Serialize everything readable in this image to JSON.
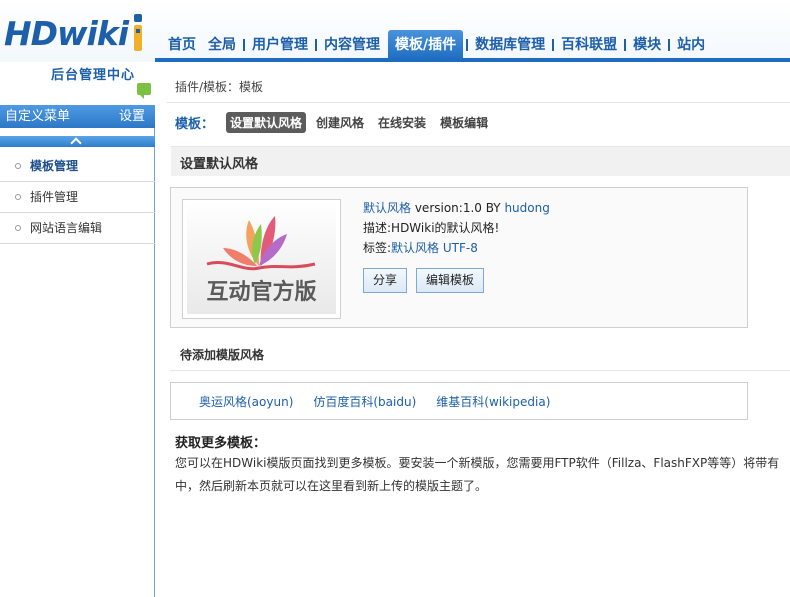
{
  "brand": {
    "logo": "HDwiki",
    "subtitle": "后台管理中心"
  },
  "topnav": [
    {
      "label": "首页",
      "active": false
    },
    {
      "label": "全局",
      "active": false
    },
    {
      "label": "用户管理",
      "active": false
    },
    {
      "label": "内容管理",
      "active": false
    },
    {
      "label": "模板/插件",
      "active": true
    },
    {
      "label": "数据库管理",
      "active": false
    },
    {
      "label": "百科联盟",
      "active": false
    },
    {
      "label": "模块",
      "active": false
    },
    {
      "label": "站内",
      "active": false
    }
  ],
  "sidebar": {
    "custom_menu_label": "自定义菜单",
    "custom_menu_setting": "设置",
    "items": [
      {
        "label": "模板管理",
        "active": true
      },
      {
        "label": "插件管理",
        "active": false
      },
      {
        "label": "网站语言编辑",
        "active": false
      }
    ]
  },
  "breadcrumb": "插件/模板：模板",
  "template_tabs": {
    "label": "模板：",
    "tabs": [
      {
        "label": "设置默认风格",
        "active": true
      },
      {
        "label": "创建风格",
        "active": false
      },
      {
        "label": "在线安装",
        "active": false
      },
      {
        "label": "模板编辑",
        "active": false
      }
    ]
  },
  "section_title": "设置默认风格",
  "current_theme": {
    "thumb_text": "互动官方版",
    "name": "默认风格",
    "version_prefix": " version:1.0 BY ",
    "author": "hudong",
    "desc_label": "描述:",
    "desc": "HDWiki的默认风格!",
    "tags_label": "标签:",
    "tags": [
      "默认风格",
      "UTF-8"
    ],
    "share_button": "分享",
    "edit_button": "编辑模板"
  },
  "pending": {
    "title": "待添加模版风格",
    "themes": [
      "奥运风格(aoyun)",
      "仿百度百科(baidu)",
      "维基百科(wikipedia)"
    ]
  },
  "more": {
    "title": "获取更多模板：",
    "line1": "您可以在HDWiki模版页面找到更多模板。要安装一个新模版，您需要用FTP软件（Fillza、FlashFXP等等）将带有",
    "line2": "中，然后刷新本页就可以在这里看到新上传的模版主题了。"
  },
  "colors": {
    "brand_blue": "#1d5fa9",
    "nav_active": "#1d6cc0",
    "tab_active": "#5c5c5c"
  },
  "icons": [
    "chat-icon",
    "chevron-up-icon",
    "bullet-icon"
  ]
}
